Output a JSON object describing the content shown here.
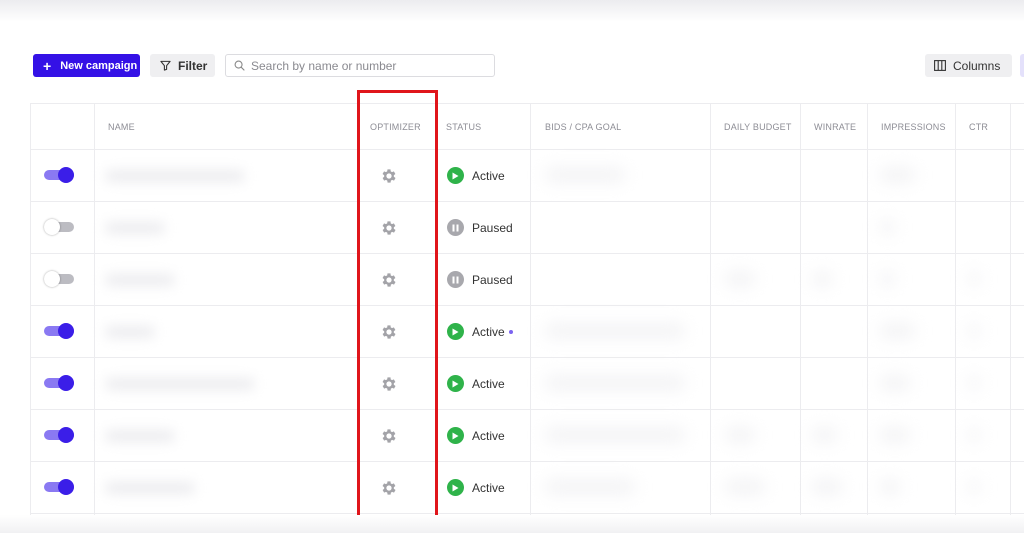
{
  "toolbar": {
    "new_campaign_label": "New campaign",
    "filter_label": "Filter",
    "search_placeholder": "Search by name or number",
    "columns_label": "Columns"
  },
  "table": {
    "headers": [
      "NAME",
      "OPTIMIZER",
      "STATUS",
      "BIDS / CPA GOAL",
      "DAILY BUDGET",
      "WINRATE",
      "IMPRESSIONS",
      "CTR"
    ],
    "rows": [
      {
        "enabled": true,
        "status": "Active",
        "status_kind": "active"
      },
      {
        "enabled": false,
        "status": "Paused",
        "status_kind": "paused"
      },
      {
        "enabled": false,
        "status": "Paused",
        "status_kind": "paused"
      },
      {
        "enabled": true,
        "status": "Active",
        "status_kind": "active",
        "indicator_dot": true
      },
      {
        "enabled": true,
        "status": "Active",
        "status_kind": "active"
      },
      {
        "enabled": true,
        "status": "Active",
        "status_kind": "active"
      },
      {
        "enabled": true,
        "status": "Active",
        "status_kind": "active"
      }
    ]
  },
  "colors": {
    "primary": "#3411e6",
    "toggle_on": "#3b1ee8",
    "active_status": "#2fb34a",
    "paused_status": "#a8a8ad",
    "highlight": "#e0151b"
  },
  "icons": {
    "new_campaign": "plus-icon",
    "filter": "funnel-icon",
    "search": "magnifier-icon",
    "columns": "columns-icon",
    "optimizer": "gear-icon",
    "active": "play-icon",
    "paused": "pause-icon"
  }
}
